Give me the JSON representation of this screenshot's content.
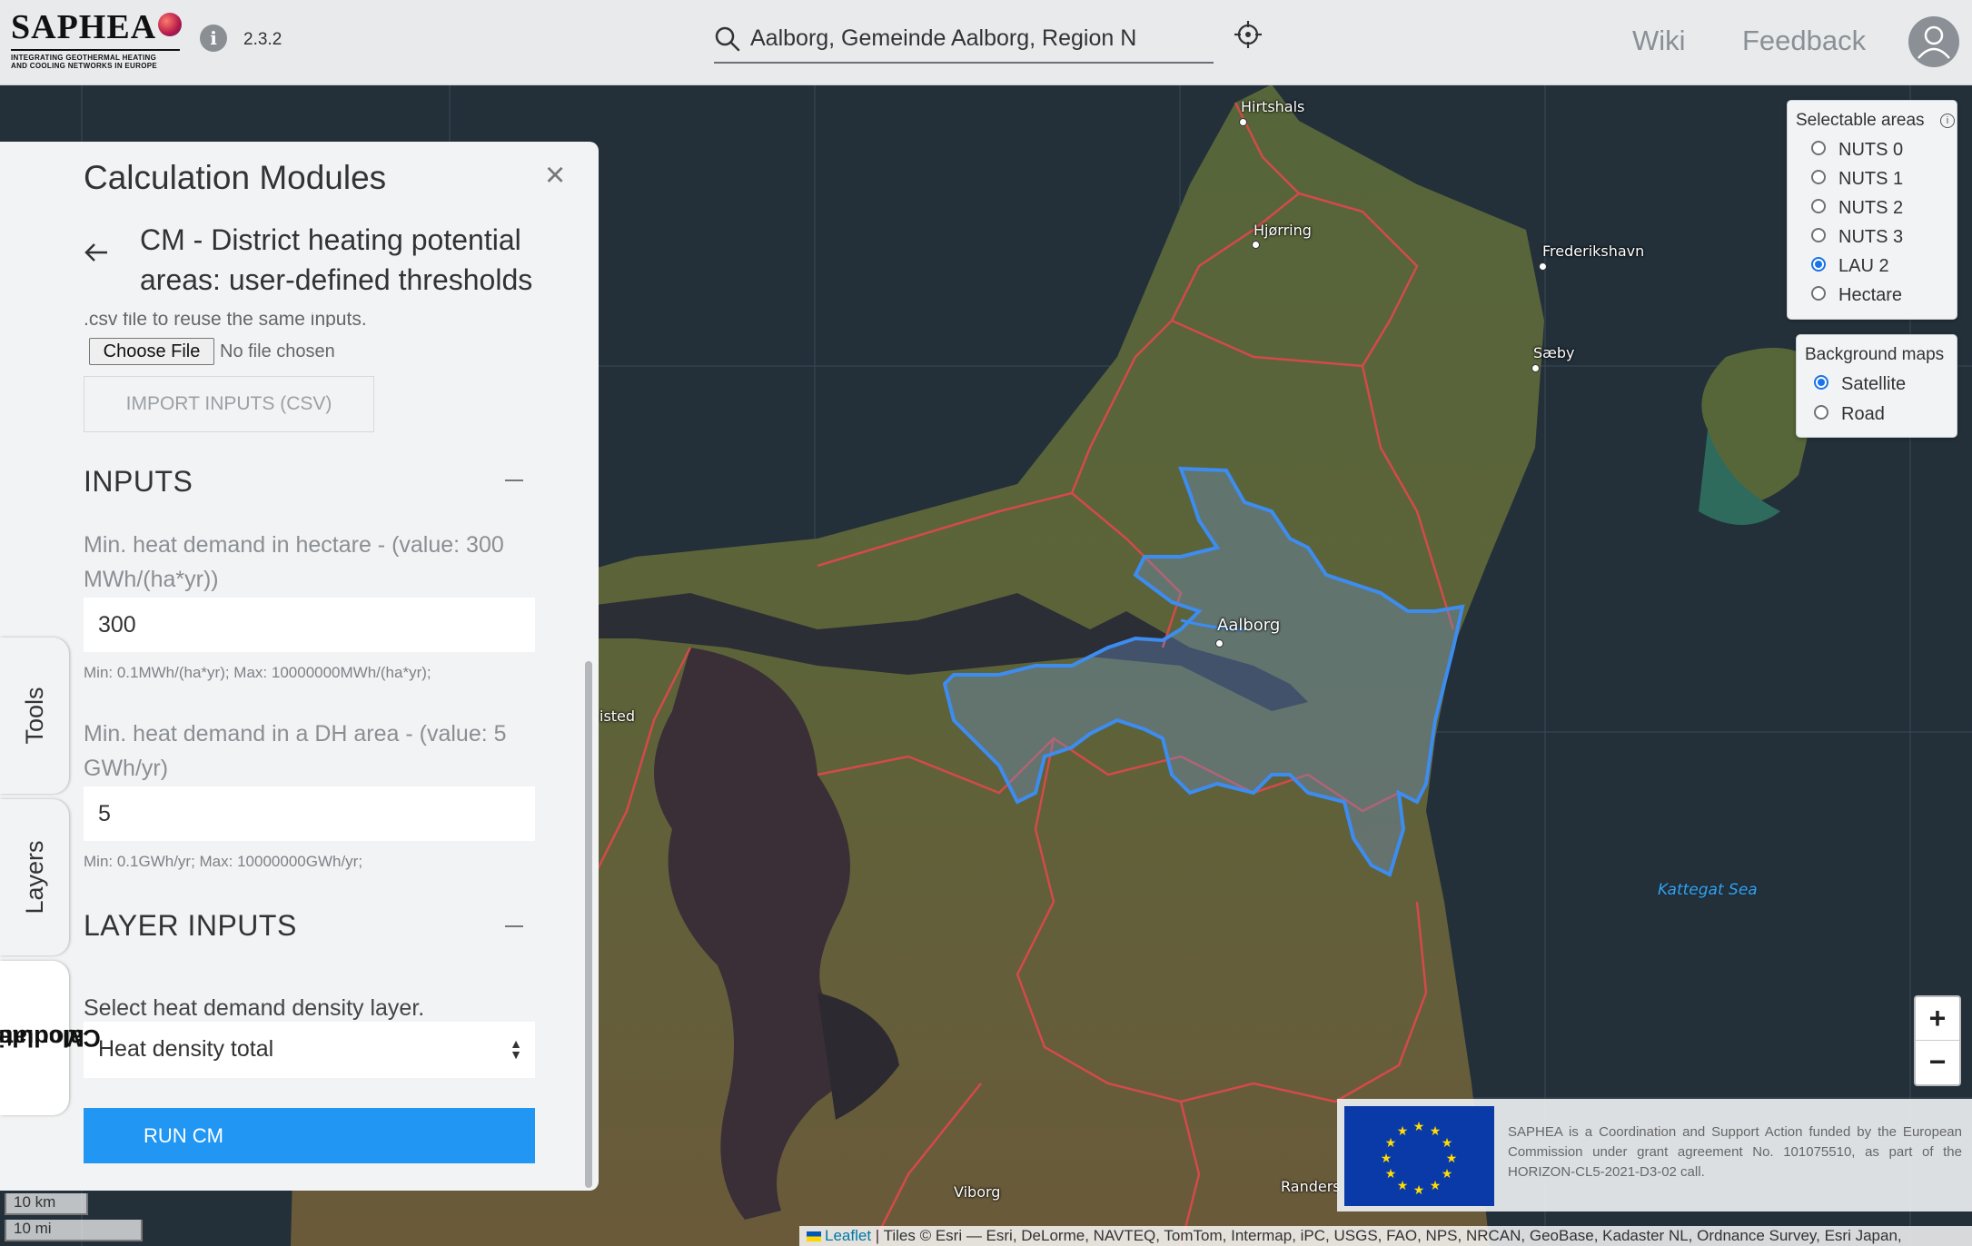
{
  "header": {
    "logo_text": "SAPHEA",
    "logo_sub_line1": "INTEGRATING GEOTHERMAL HEATING",
    "logo_sub_line2": "AND COOLING NETWORKS IN EUROPE",
    "version": "2.3.2",
    "search_value": "Aalborg, Gemeinde Aalborg, Region N",
    "nav": {
      "wiki": "Wiki",
      "feedback": "Feedback"
    }
  },
  "map": {
    "labels": {
      "hirtshals": "Hirtshals",
      "hjorring": "Hjørring",
      "frederikshavn": "Frederikshavn",
      "saeby": "Sæby",
      "aalborg": "Aalborg",
      "thisted_partial": "isted",
      "viborg": "Viborg",
      "randers": "Randers",
      "kattegat": "Kattegat Sea"
    },
    "colors": {
      "boundary": "#e0484b",
      "selection": "#3d8cf0"
    }
  },
  "selectable_areas": {
    "title": "Selectable areas",
    "options": [
      "NUTS 0",
      "NUTS 1",
      "NUTS 2",
      "NUTS 3",
      "LAU 2",
      "Hectare"
    ],
    "selected": "LAU 2"
  },
  "background_maps": {
    "title": "Background maps",
    "options": [
      "Satellite",
      "Road"
    ],
    "selected": "Satellite"
  },
  "zoom": {
    "in": "+",
    "out": "−"
  },
  "side_tabs": {
    "tools": "Tools",
    "layers": "Layers",
    "calc_line1": "Calculation",
    "calc_line2": "Modules"
  },
  "panel": {
    "title": "Calculation Modules",
    "close": "×",
    "cm_title": "CM - District heating potential areas: user-defined thresholds",
    "cut_text": ".csv file to reuse the same inputs.",
    "choose_file": "Choose File",
    "no_file": "No file chosen",
    "import_button": "IMPORT INPUTS (CSV)",
    "inputs_heading": "INPUTS",
    "field1": {
      "label": "Min. heat demand in hectare - (value: 300 MWh/(ha*yr))",
      "value": "300",
      "hint": "Min: 0.1MWh/(ha*yr); Max: 10000000MWh/(ha*yr);"
    },
    "field2": {
      "label": "Min. heat demand in a DH area - (value: 5 GWh/yr)",
      "value": "5",
      "hint": "Min: 0.1GWh/yr; Max: 10000000GWh/yr;"
    },
    "layer_inputs_heading": "LAYER INPUTS",
    "select_label": "Select heat demand density layer.",
    "select_value": "Heat density total",
    "run_button": "RUN CM"
  },
  "eu_box": {
    "text": "SAPHEA is a Coordination and Support Action funded by the European Commission under grant agreement No. 101075510, as part of the HORIZON-CL5-2021-D3-02 call."
  },
  "scale": {
    "km": "10 km",
    "mi": "10 mi"
  },
  "attribution": {
    "leaflet": "Leaflet",
    "text": " | Tiles © Esri — Esri, DeLorme, NAVTEQ, TomTom, Intermap, iPC, USGS, FAO, NPS, NRCAN, GeoBase, Kadaster NL, Ordnance Survey, Esri Japan,"
  }
}
